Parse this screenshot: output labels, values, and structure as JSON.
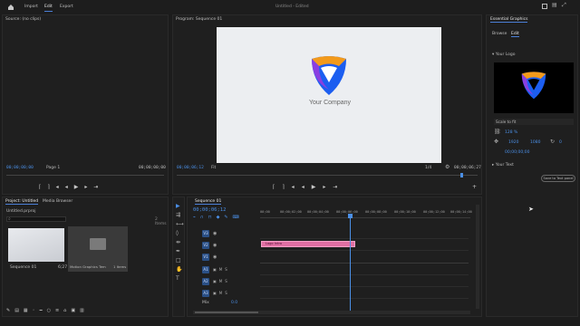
{
  "topbar": {
    "tabs": [
      {
        "label": "Import"
      },
      {
        "label": "Edit"
      },
      {
        "label": "Export"
      }
    ],
    "doc_title": "Untitled",
    "doc_status": "- Edited"
  },
  "source": {
    "tab_label": "Source: (no clips)",
    "timecode_left": "00;00;00;00",
    "page_label": "Page 1",
    "timecode_right": "00;00;00;00"
  },
  "program": {
    "tab_label": "Program: Sequence 01",
    "timecode_left": "00;00;06;12",
    "fit_label": "Fit",
    "quality": "1/4",
    "timecode_right": "00;00;06;27",
    "preview": {
      "company": "Your Company",
      "logo_colors": [
        "#f39a1b",
        "#8a3fe0",
        "#1c5ef0"
      ]
    }
  },
  "project": {
    "tab_label": "Project: Untitled",
    "tab2_label": "Media Browser",
    "file_name": "Untitled.prproj",
    "item_count": "2 Items",
    "items": [
      {
        "name": "Sequence 01",
        "duration": "6;27"
      },
      {
        "name": "Motion Graphics Templa...",
        "count": "1 Items"
      }
    ]
  },
  "timeline": {
    "tab_label": "Sequence 01",
    "timecode": "00;00;06;12",
    "ruler": [
      "00;00",
      "00;00;02;00",
      "00;00;04;00",
      "00;00;06;00",
      "00;00;08;00",
      "00;00;10;00",
      "00;00;12;00",
      "00;00;14;00"
    ],
    "clip_label": "Logo Intro",
    "tracks": [
      {
        "label": "V3"
      },
      {
        "label": "V2"
      },
      {
        "label": "V1"
      },
      {
        "label": "A1"
      },
      {
        "label": "A2"
      },
      {
        "label": "A3"
      }
    ],
    "master_label": "Mix",
    "master_value": "0.0"
  },
  "essential_graphics": {
    "tab_label": "Essential Graphics",
    "subtabs": [
      {
        "label": "Browse"
      },
      {
        "label": "Edit"
      }
    ],
    "layer_label": "Your Logo",
    "scale_label": "Scale to fit",
    "pos_x": "1920",
    "pos_y": "1080",
    "rotation": "0",
    "opacity_val": "100 %",
    "scale_val": "128 %",
    "timecode": "00;00;00;00",
    "text_layer": "Your Text",
    "save_label": "Save to Text panel"
  }
}
